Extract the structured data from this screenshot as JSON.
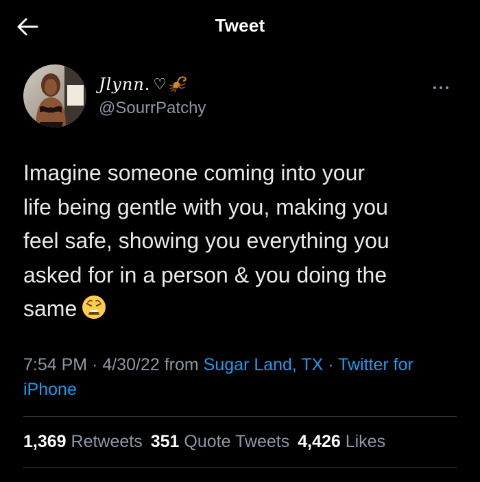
{
  "header": {
    "title": "Tweet",
    "back_icon": "arrow-left-icon"
  },
  "author": {
    "display_name": "Jlynn.",
    "heart": "♡",
    "scorpion_icon": "scorpion-emoji-icon",
    "handle": "@SourrPatchy",
    "more_icon": "more-horizontal-icon"
  },
  "tweet": {
    "text": "Imagine someone coming into your\nlife being gentle with you, making you\nfeel safe, showing you everything you\nasked for in a person & you doing the\nsame",
    "emoji": "weary-face-emoji-icon"
  },
  "meta": {
    "time": "7:54 PM",
    "sep1": " · ",
    "date": "4/30/22",
    "from": " from ",
    "location": "Sugar Land, TX",
    "sep2": " · ",
    "source": "Twitter for iPhone"
  },
  "stats": {
    "retweets_count": "1,369",
    "retweets_label": "Retweets",
    "quotes_count": "351",
    "quotes_label": "Quote Tweets",
    "likes_count": "4,426",
    "likes_label": "Likes"
  },
  "colors": {
    "background": "#000000",
    "text": "#e7e9ea",
    "secondary": "#8b98a5",
    "link": "#1d9bf0",
    "divider": "#2f3336"
  }
}
